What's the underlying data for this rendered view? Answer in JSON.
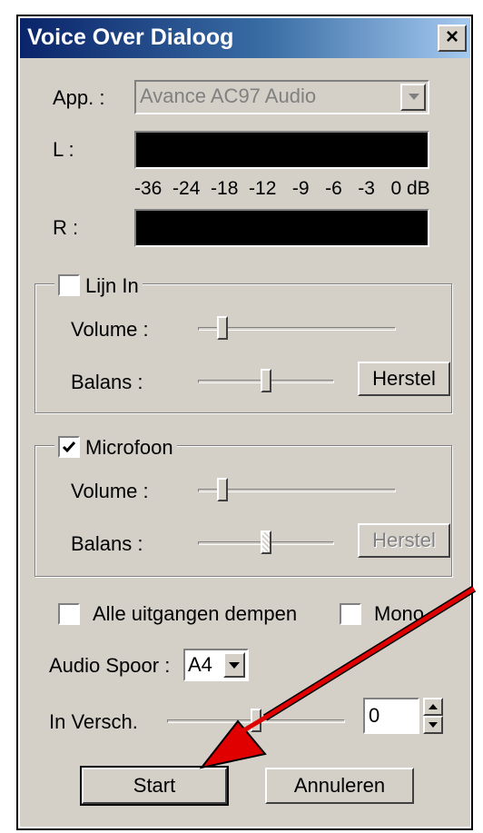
{
  "window": {
    "title": "Voice Over Dialoog",
    "close_label": "×"
  },
  "app": {
    "label": "App. :",
    "device": "Avance AC97 Audio"
  },
  "meters": {
    "left_label": "L :",
    "right_label": "R :",
    "scale": "-36  -24  -18  -12   -9   -6   -3   0 dB"
  },
  "line_in": {
    "label": "Lijn In",
    "checked": false,
    "volume_label": "Volume :",
    "volume_level": 0.1,
    "balance_label": "Balans :",
    "balance_level": 0.5,
    "reset_label": "Herstel"
  },
  "microphone": {
    "label": "Microfoon",
    "checked": true,
    "volume_label": "Volume :",
    "volume_level": 0.1,
    "balance_label": "Balans :",
    "balance_level": 0.5,
    "reset_label": "Herstel"
  },
  "options": {
    "mute_all_label": "Alle uitgangen dempen",
    "mono_label": "Mono"
  },
  "audio_track": {
    "label": "Audio Spoor :",
    "value": "A4"
  },
  "offset": {
    "label": "In Versch.",
    "value": "0",
    "slider_level": 0.5
  },
  "buttons": {
    "start": "Start",
    "cancel": "Annuleren"
  }
}
